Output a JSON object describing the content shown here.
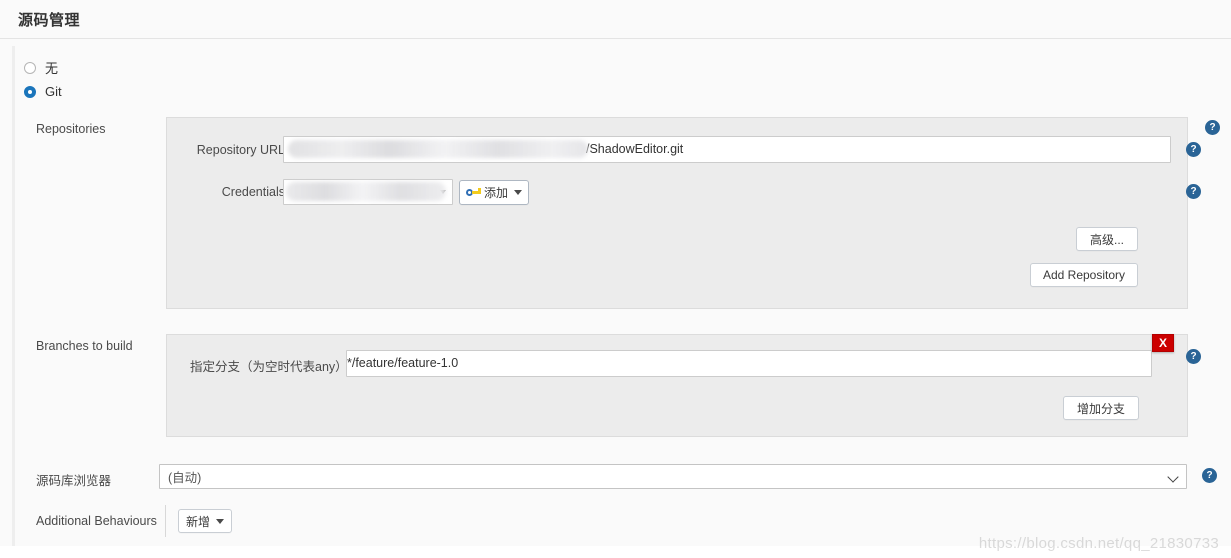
{
  "section": {
    "title": "源码管理"
  },
  "scm_options": [
    {
      "label": "无",
      "selected": false
    },
    {
      "label": "Git",
      "selected": true
    }
  ],
  "repositories": {
    "row_label": "Repositories",
    "repository_url": {
      "label": "Repository URL",
      "value": "/ShadowEditor.git",
      "redacted_prefix": true
    },
    "credentials": {
      "label": "Credentials",
      "value": "",
      "redacted": true,
      "add_button": "添加",
      "add_button_icon": "key-icon"
    },
    "advanced_button": "高级...",
    "add_repository_button": "Add Repository"
  },
  "branches": {
    "row_label": "Branches to build",
    "branch_specifier": {
      "label": "指定分支（为空时代表any）",
      "value": "*/feature/feature-1.0"
    },
    "delete_label": "X",
    "add_branch_button": "增加分支"
  },
  "repository_browser": {
    "row_label": "源码库浏览器",
    "selected": "(自动)"
  },
  "additional_behaviours": {
    "row_label": "Additional Behaviours",
    "add_button": "新增"
  },
  "help_icons": {
    "glyph": "?"
  },
  "watermark": "https://blog.csdn.net/qq_21830733",
  "colors": {
    "accent_blue": "#2a6496",
    "radio_blue": "#1b75bb",
    "delete_red": "#cc0000",
    "panel_bg": "#ececec",
    "page_bg": "#fafafa"
  }
}
